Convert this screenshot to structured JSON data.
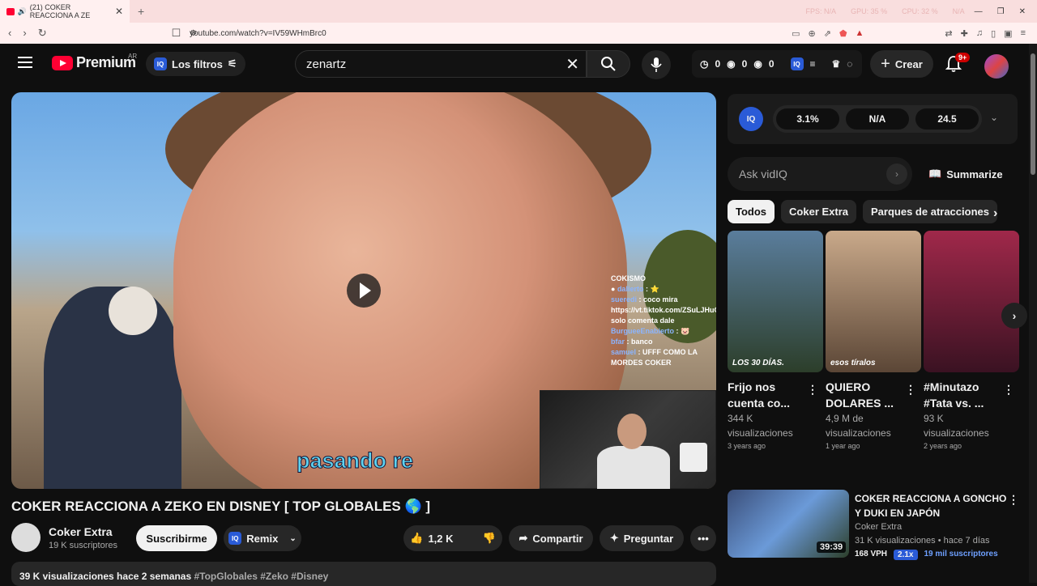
{
  "browser": {
    "tab_title": "(21) COKER REACCIONA A ZE",
    "url": "youtube.com/watch?v=IV59WHmBrc0",
    "stats": [
      "FPS: N/A",
      "GPU: 35 %",
      "CPU: 32 %",
      "N/A"
    ]
  },
  "header": {
    "logo_text": "Premium",
    "country": "AR",
    "filters_label": "Los filtros",
    "search_value": "zenartz",
    "counters": [
      "0",
      "0",
      "0"
    ],
    "create_label": "Crear",
    "notifications": "9+"
  },
  "video": {
    "subtitle": "pasando re",
    "chat_title": "COKISMO",
    "chat": [
      {
        "user": "dalierto",
        "msg": ": ⭐"
      },
      {
        "user": "sueredi",
        "msg": ": coco mira https://vt.tiktok.com/ZSuLJHuCd/ solo comenta dale"
      },
      {
        "user": "BurgueeEnabierto",
        "msg": ": 🐷"
      },
      {
        "user": "bfar",
        "msg": ": banco"
      },
      {
        "user": "samuel",
        "msg": ": UFFF COMO LA MORDES COKER"
      }
    ],
    "title": "COKER REACCIONA A ZEKO EN DISNEY [ TOP GLOBALES 🌎 ]",
    "channel": "Coker Extra",
    "subscribers": "19 K suscriptores",
    "subscribe_label": "Suscribirme",
    "remix_label": "Remix",
    "likes": "1,2 K",
    "share_label": "Compartir",
    "ask_label": "Preguntar",
    "desc_meta": "39 K visualizaciones  hace 2 semanas",
    "desc_tags": "#TopGlobales #Zeko #Disney"
  },
  "vidiq": {
    "metrics": [
      "3.1%",
      "N/A",
      "24.5"
    ],
    "ask_placeholder": "Ask vidIQ",
    "summarize_label": "Summarize"
  },
  "chips": [
    "Todos",
    "Coker Extra",
    "Parques de atracciones"
  ],
  "shorts": [
    {
      "title": "Frijo nos cuenta co...",
      "views": "344 K visualizaciones",
      "age": "3 years ago",
      "thumb_text": "LOS 30 DÍAS.",
      "colors": [
        "#5a7d9c",
        "#2c3e2a"
      ]
    },
    {
      "title": "QUIERO DOLARES ...",
      "views": "4,9 M de visualizaciones",
      "age": "1 year ago",
      "thumb_text": "esos tíralos",
      "colors": [
        "#c9a98a",
        "#5b4636"
      ]
    },
    {
      "title": "#Minutazo #Tata vs. ...",
      "views": "93 K visualizaciones",
      "age": "2 years ago",
      "thumb_text": "",
      "colors": [
        "#a0284a",
        "#3a1222"
      ]
    }
  ],
  "recommended": {
    "title": "COKER REACCIONA A GONCHO Y DUKI EN JAPÓN",
    "channel": "Coker Extra",
    "meta": "31 K visualizaciones • hace 7 días",
    "duration": "39:39",
    "vph": "168 VPH",
    "ratio": "2.1x",
    "subs": "19 mil suscriptores"
  }
}
